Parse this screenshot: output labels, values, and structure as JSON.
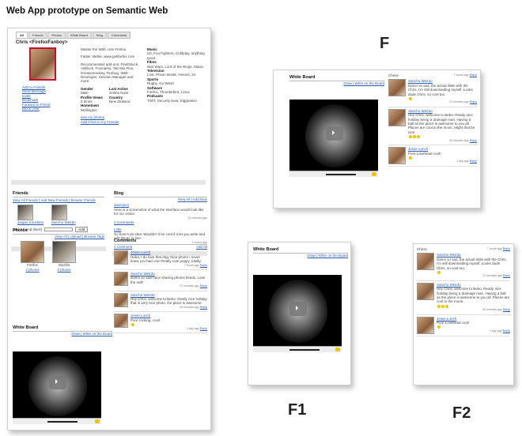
{
  "page_title": "Web App prototype on Semantic Web",
  "labels": {
    "f": "F",
    "f1": "F1",
    "f2": "F2"
  },
  "profile": {
    "tabs": [
      "All",
      "Friends",
      "Photos",
      "White Board",
      "Blog",
      "Comments"
    ],
    "name": "Chris <FirefoxFanboy>",
    "about": "Master the Web. Use Firefox.",
    "fav_color": "Faster. Better. www.getfirefox.com",
    "recommended": "Recommended add-ons: Flashblock, Adblock, Foxmarks, Tab Mix Plus, Greasemonkey, Firebug, Web Developer, Session Manager and more.",
    "music_title": "Music",
    "music": "U2, Foo Fighters, Coldplay, anything good",
    "films_title": "Films",
    "films": "Star Wars, Lord of the Rings, Matrix",
    "tv_title": "Television",
    "tv": "Lost, Prison Break, Heroes, 24",
    "sports_title": "Sports",
    "sports": "Rugby, Go West!",
    "software_title": "Software",
    "software": "Firefox, Thunderbird, Linux",
    "podcasts_title": "Podcasts",
    "podcasts": "TWiT, Security Now, Diggnation",
    "actions": [
      "Add to Friends",
      "Send Message",
      "Invite",
      "Bookmark",
      "Forward to Friend",
      "Block User"
    ],
    "gender_label": "Gender",
    "gender": "Male",
    "status_label": "Profile Views",
    "status": "0 times",
    "hometown_label": "Hometown",
    "hometown": "Wellington",
    "country_label": "Country",
    "country": "New Zealand",
    "last_active_label": "Last Active",
    "last_active": "Online Now!",
    "links": [
      "See my photos",
      "Add Chris to my Friends"
    ]
  },
  "friends": {
    "title": "Friends",
    "actions": "View All Friends | Add New Friends | Browse Friends",
    "names": [
      "Jasper Knuckles",
      "Sancho Weirdo"
    ],
    "add_label": "Add a friend (Nick)",
    "add_button": "Add"
  },
  "blog": {
    "title": "Blog",
    "actions": "View All | Add New",
    "posts": [
      {
        "title": "Jasmine1",
        "body": "Here is a screenshot of what the interface would look like for our visitor.",
        "time": "11 minutes ago",
        "comments": "2 Comments"
      },
      {
        "title": "Little",
        "body": "So here's an idea: Wouldn't it be cool if it let you write and edit things in-line.",
        "time": "2 hours ago",
        "comments": "1 Comment"
      }
    ]
  },
  "photos": {
    "title": "Photos",
    "actions": "View All | Upload | Browse Tags",
    "items": [
      {
        "caption": "Firefox",
        "link": "2 photos"
      },
      {
        "caption": "Mozilla",
        "link": "3 photos"
      }
    ]
  },
  "comments": {
    "title": "Comments",
    "actions": "Add All",
    "items": [
      {
        "name": "Jesse Lunch",
        "text": "Haha, I do love that dog. Nice photo! I never knew you had one! Really cute puppy, totally.",
        "time": "7 hours ago",
        "reply": "Reply"
      },
      {
        "name": "Sancho Weirdo",
        "text": "Damn so sad! Nice sharing photos fiends, Lose the red!!",
        "time": "27 minutes ago",
        "reply": "Reply"
      },
      {
        "name": "Sancho Weirdo",
        "text": "Hey Chris, welcome to Bebo. Really nice holiday that is very nice photo, the place is awesome.",
        "time": "52 minutes ago",
        "reply": "Reply"
      },
      {
        "name": "Jesse Lunch",
        "text": "Pure rocking, cool!",
        "time": "1 day ago",
        "reply": "Reply"
      }
    ]
  },
  "whiteboard": {
    "title": "White Board",
    "actions": "Draw | Write on the Board"
  },
  "panel_f": {
    "whiteboard_title": "White Board",
    "whiteboard_actions": "Draw | Write on the Board",
    "comments_header": "Chess",
    "top_time": "7 hours ago",
    "top_reply": "Reply",
    "comments": [
      {
        "name": "Sancho Weirdo",
        "text": "Damn so sad, the actual slide with the Chris, I'm still downloading myself. Looks dude Chris, so cool too.",
        "time": "27 minutes ago",
        "reply": "Reply"
      },
      {
        "name": "Sancho Weirdo",
        "text": "Hey Chris, welcome to Bebo. Ready nice holiday being a drainage man. Having a ball as the place is awesome to you all. Places are cool to the moon. Might that be nice.",
        "time": "52 minutes ago",
        "reply": "Reply"
      },
      {
        "name": "Jesse Lunch",
        "text": "Pure Lovehead cool!",
        "time": "1 day ago",
        "reply": "Reply"
      }
    ]
  },
  "panel_f1": {
    "whiteboard_title": "White Board",
    "whiteboard_actions": "Draw | Write on the Board"
  },
  "panel_f2": {
    "comments_header": "Chess",
    "top_time": "7 hours ago",
    "top_reply": "Reply",
    "comments": [
      {
        "name": "Sancho Weirdo",
        "text": "Damn so sad, the actual slide with the Chris, I'm still downloading myself. Looks dude Chris, so cool too.",
        "time": "27 minutes ago",
        "reply": "Reply"
      },
      {
        "name": "Sancho Weirdo",
        "text": "Hey Chris, welcome to Bebo. Ready nice holiday being a drainage man. Having a ball as the place is awesome to you all. Places are cool to the moon.",
        "time": "52 minutes ago",
        "reply": "Reply"
      },
      {
        "name": "Jesse Lunch",
        "text": "Pure Lovehead cool!",
        "time": "1 day ago",
        "reply": "Reply"
      }
    ]
  }
}
